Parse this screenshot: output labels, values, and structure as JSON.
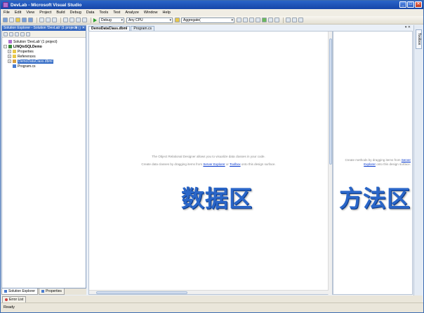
{
  "window": {
    "title": "DevLab - Microsoft Visual Studio"
  },
  "menu": [
    "File",
    "Edit",
    "View",
    "Project",
    "Build",
    "Debug",
    "Data",
    "Tools",
    "Test",
    "Analyze",
    "Window",
    "Help"
  ],
  "toolbar": {
    "configuration": "Debug",
    "platform": "Any CPU",
    "find_text": "Aggregate("
  },
  "solution_explorer": {
    "header": "Solution Explorer - Solution 'DevLab' (1 project)",
    "header_controls": "▾ ◻ ✕",
    "tree": [
      {
        "label": "Solution 'DevLab' (1 project)",
        "level": 0,
        "icon": "solution-icon",
        "expander": ""
      },
      {
        "label": "LINQtoSQLDemo",
        "level": 1,
        "icon": "project-icon",
        "expander": "−",
        "bold": true
      },
      {
        "label": "Properties",
        "level": 2,
        "icon": "folder-icon",
        "expander": "+"
      },
      {
        "label": "References",
        "level": 2,
        "icon": "folder-icon",
        "expander": "+"
      },
      {
        "label": "DemoDataClass.dbml",
        "level": 2,
        "icon": "dbml-icon",
        "expander": "+",
        "selected": true
      },
      {
        "label": "Program.cs",
        "level": 2,
        "icon": "cs-file-icon",
        "expander": ""
      }
    ],
    "bottom_tabs": [
      "Solution Explorer",
      "Properties"
    ]
  },
  "document_tabs": [
    {
      "label": "DemoDataClass.dbml",
      "active": true
    },
    {
      "label": "Program.cs",
      "active": false
    }
  ],
  "doc_tab_controls": "▾ ✕",
  "designer": {
    "hint_line1": "The Object Relational Designer allows you to visualize data classes in your code.",
    "hint_line2_prefix": "Create data classes by dragging items from ",
    "hint_link1": "Server Explorer",
    "hint_mid": " or ",
    "hint_link2": "Toolbox",
    "hint_suffix": " onto this design surface.",
    "overlay_label": "数据区"
  },
  "methods_pane": {
    "hint_prefix": "Create methods by dragging items from ",
    "hint_link": "Server Explorer",
    "hint_suffix": " onto this design surface.",
    "overlay_label": "方法区"
  },
  "toolbox_tab": "Toolbox",
  "error_list_tab": "Error List",
  "status": "Ready"
}
